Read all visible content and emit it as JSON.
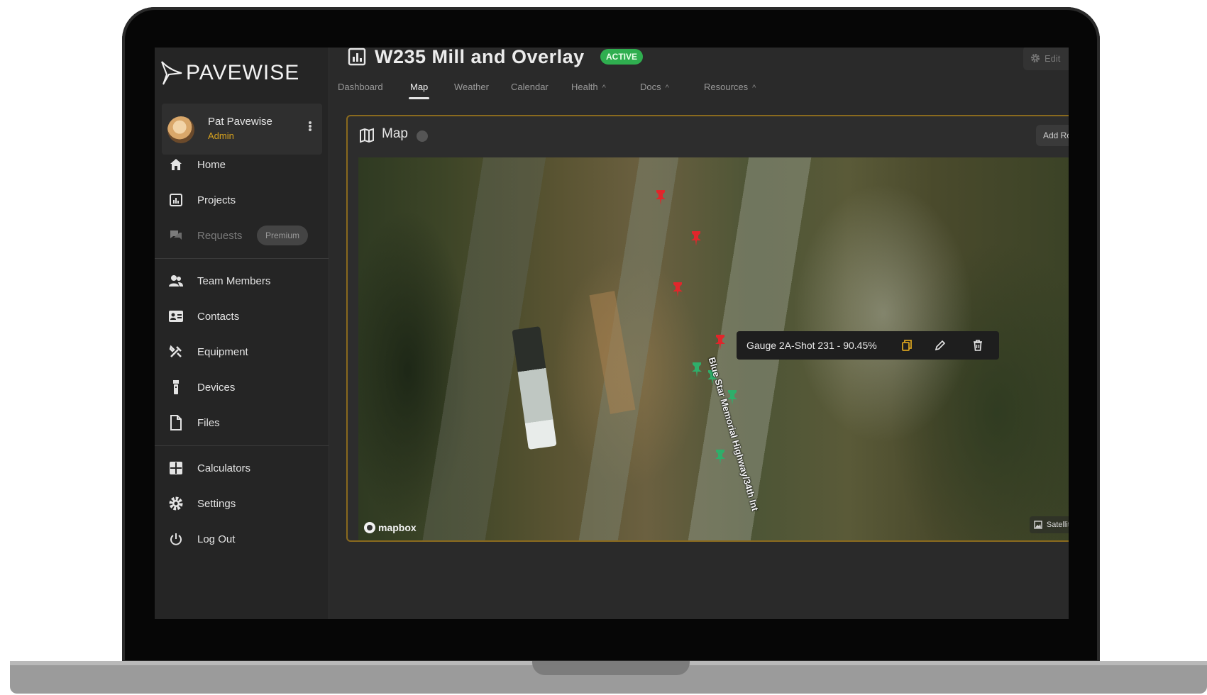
{
  "app": {
    "brand": "PAVEWISE"
  },
  "user": {
    "name": "Pat Pavewise",
    "role": "Admin"
  },
  "sidebar": {
    "items": [
      {
        "label": "Home",
        "icon": "home-icon"
      },
      {
        "label": "Projects",
        "icon": "projects-icon"
      },
      {
        "label": "Requests",
        "icon": "requests-icon",
        "badge": "Premium"
      },
      {
        "label": "Team Members",
        "icon": "team-icon"
      },
      {
        "label": "Contacts",
        "icon": "contacts-icon"
      },
      {
        "label": "Equipment",
        "icon": "equipment-icon"
      },
      {
        "label": "Devices",
        "icon": "device-icon"
      },
      {
        "label": "Files",
        "icon": "file-icon"
      },
      {
        "label": "Calculators",
        "icon": "calculator-icon"
      },
      {
        "label": "Settings",
        "icon": "gear-icon"
      },
      {
        "label": "Log Out",
        "icon": "power-icon"
      }
    ]
  },
  "project": {
    "title": "W235 Mill and Overlay",
    "status": "ACTIVE",
    "edit_label": "Edit"
  },
  "tabs": [
    {
      "label": "Dashboard"
    },
    {
      "label": "Map",
      "active": true
    },
    {
      "label": "Weather"
    },
    {
      "label": "Calendar"
    },
    {
      "label": "Health"
    },
    {
      "label": "Docs"
    },
    {
      "label": "Resources"
    }
  ],
  "map": {
    "title": "Map",
    "add_button": "Add Ro",
    "popup_text": "Gauge 2A-Shot 231 - 90.45%",
    "road_label": "Blue Star Memorial Highway/34th Int",
    "attribution": "mapbox",
    "layer_toggle": "Satellite",
    "colors": {
      "pin_fail": "#e0262b",
      "pin_pass": "#2fae6a",
      "panel_border": "#8a6a1e",
      "active_badge": "#2fae4f"
    }
  }
}
